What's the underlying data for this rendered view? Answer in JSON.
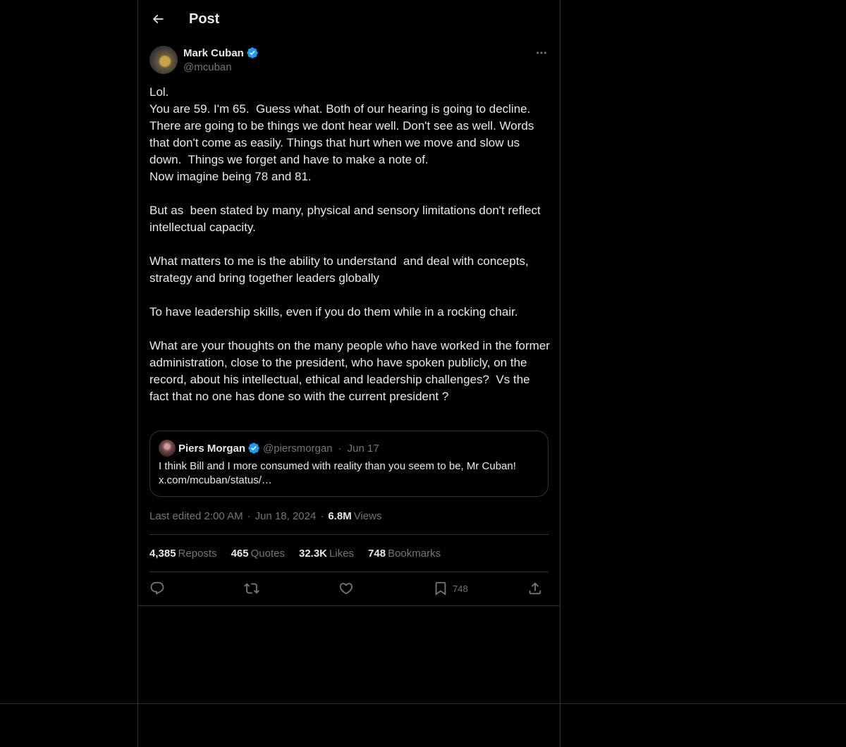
{
  "header": {
    "title": "Post",
    "back_icon": "arrow-left-icon"
  },
  "author": {
    "name": "Mark Cuban",
    "handle": "@mcuban",
    "verified_icon": "verified-badge-icon",
    "more_icon": "more-horizontal-icon"
  },
  "post": {
    "text": "Lol.\nYou are 59. I'm 65.  Guess what. Both of our hearing is going to decline.\nThere are going to be things we dont hear well. Don't see as well. Words that don't come as easily. Things that hurt when we move and slow us down.  Things we forget and have to make a note of.\nNow imagine being 78 and 81.\n\nBut as  been stated by many, physical and sensory limitations don't reflect intellectual capacity.\n\nWhat matters to me is the ability to understand  and deal with concepts, strategy and bring together leaders globally\n\nTo have leadership skills, even if you do them while in a rocking chair.\n\nWhat are your thoughts on the many people who have worked in the former administration, close to the president, who have spoken publicly, on the record, about his intellectual, ethical and leadership challenges?  Vs the fact that no one has done so with the current president ?"
  },
  "quote": {
    "name": "Piers Morgan",
    "handle": "@piersmorgan",
    "separator": "·",
    "date": "Jun 17",
    "text_line1": "I think Bill and I more consumed with reality than you seem to be, Mr Cuban!",
    "text_line2": "x.com/mcuban/status/…"
  },
  "meta": {
    "edited": "Last edited 2:00 AM",
    "separator": "·",
    "date": "Jun 18, 2024",
    "views_count": "6.8M",
    "views_label": "Views"
  },
  "stats": [
    {
      "count": "4,385",
      "label": "Reposts"
    },
    {
      "count": "465",
      "label": "Quotes"
    },
    {
      "count": "32.3K",
      "label": "Likes"
    },
    {
      "count": "748",
      "label": "Bookmarks"
    }
  ],
  "actions": {
    "reply_icon": "reply-icon",
    "repost_icon": "repost-icon",
    "like_icon": "heart-icon",
    "bookmark_icon": "bookmark-icon",
    "bookmark_count": "748",
    "share_icon": "share-icon"
  },
  "colors": {
    "background": "#000000",
    "text": "#e7e9ea",
    "secondary_text": "#71767b",
    "border": "#2f3336",
    "verified": "#1d9bf0"
  }
}
